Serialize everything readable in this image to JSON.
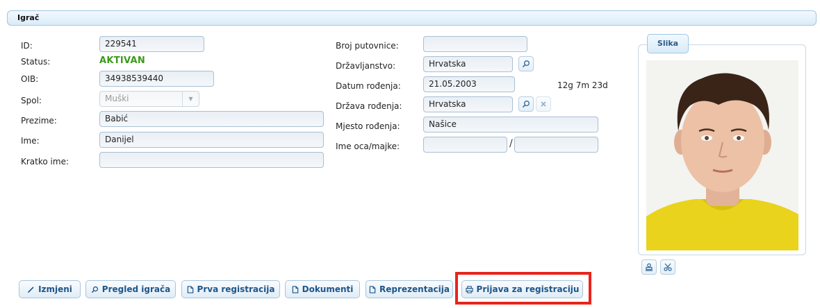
{
  "panel": {
    "title": "Igrač"
  },
  "left": {
    "id_label": "ID:",
    "id_value": "229541",
    "status_label": "Status:",
    "status_value": "AKTIVAN",
    "oib_label": "OIB:",
    "oib_value": "34938539440",
    "spol_label": "Spol:",
    "spol_value": "Muški",
    "prezime_label": "Prezime:",
    "prezime_value": "Babić",
    "ime_label": "Ime:",
    "ime_value": "Danijel",
    "kratko_label": "Kratko ime:",
    "kratko_value": ""
  },
  "middle": {
    "putovnica_label": "Broj putovnice:",
    "putovnica_value": "",
    "drzavljanstvo_label": "Državljanstvo:",
    "drzavljanstvo_value": "Hrvatska",
    "datum_label": "Datum rođenja:",
    "datum_value": "21.05.2003",
    "age": "12g 7m 23d",
    "drzava_label": "Država rođenja:",
    "drzava_value": "Hrvatska",
    "mjesto_label": "Mjesto rođenja:",
    "mjesto_value": "Našice",
    "roditelj_label": "Ime oca/majke:",
    "otac_value": "",
    "majka_value": "",
    "separator": "/"
  },
  "photo": {
    "title": "Slika"
  },
  "actions": {
    "izmjeni": "Izmjeni",
    "pregled": "Pregled igrača",
    "prva": "Prva registracija",
    "dokumenti": "Dokumenti",
    "reprezentacija": "Reprezentacija",
    "prijava": "Prijava za registraciju"
  },
  "colors": {
    "accent": "#1f5588",
    "status": "#3a9a1a",
    "highlight": "#e8241c"
  },
  "icons": [
    "search-icon",
    "clear-icon",
    "stamp-icon",
    "scissors-icon",
    "pencil-icon",
    "document-icon",
    "printer-icon"
  ]
}
